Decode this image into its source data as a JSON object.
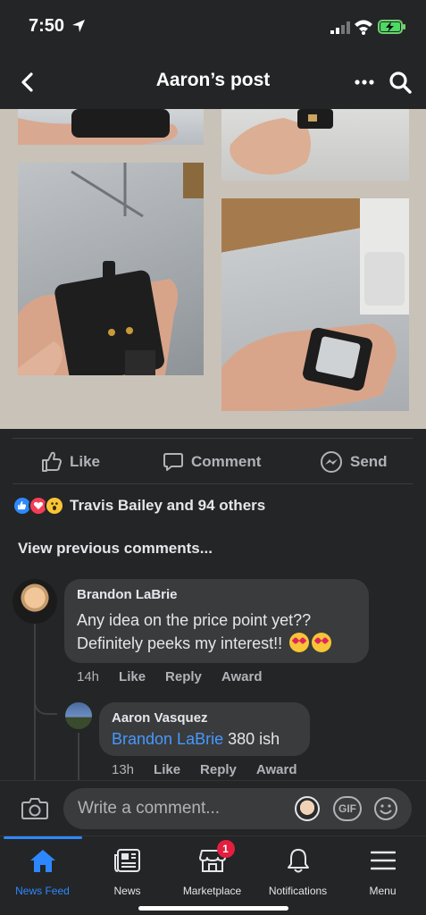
{
  "status_bar": {
    "time": "7:50"
  },
  "header": {
    "title": "Aaron’s post"
  },
  "actions": {
    "like": "Like",
    "comment": "Comment",
    "send": "Send"
  },
  "reactions": {
    "summary": "Travis Bailey and 94 others"
  },
  "comments": {
    "view_previous": "View previous comments...",
    "items": [
      {
        "author": "Brandon LaBrie",
        "text_line1": "Any idea on the price point yet??",
        "text_line2": "Definitely peeks my interest!!",
        "time": "14h",
        "like": "Like",
        "reply": "Reply",
        "award": "Award"
      },
      {
        "author": "Aaron Vasquez",
        "mention": "Brandon LaBrie",
        "text": "380 ish",
        "time": "13h",
        "like": "Like",
        "reply": "Reply",
        "award": "Award"
      }
    ]
  },
  "composer": {
    "placeholder": "Write a comment...",
    "gif_label": "GIF"
  },
  "tabs": [
    {
      "label": "News Feed",
      "active": true
    },
    {
      "label": "News"
    },
    {
      "label": "Marketplace",
      "badge": "1"
    },
    {
      "label": "Notifications"
    },
    {
      "label": "Menu"
    }
  ],
  "colors": {
    "accent": "#2d88ff",
    "mention": "#4599ff",
    "badge": "#e41e3f",
    "background": "#242526"
  }
}
